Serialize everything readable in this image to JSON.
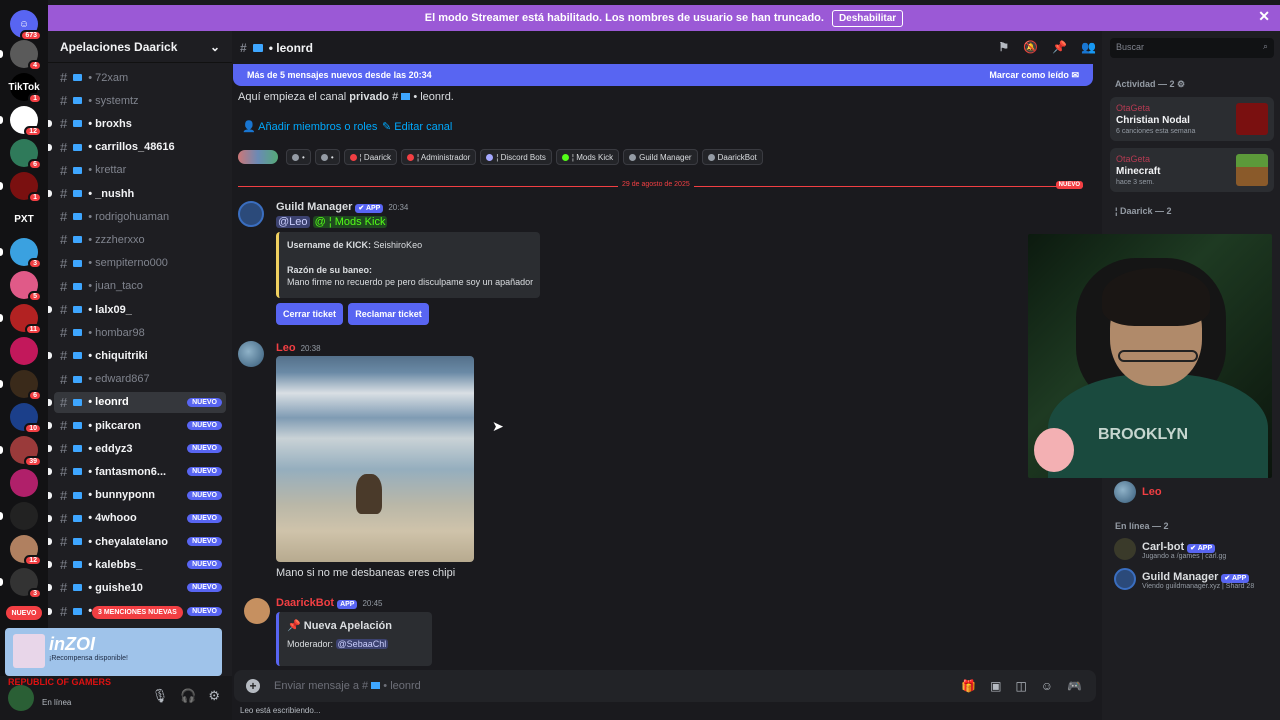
{
  "banner": {
    "text": "El modo Streamer está habilitado. Los nombres de usuario se han truncado.",
    "button": "Deshabilitar"
  },
  "rail": {
    "top_badge": "673",
    "servers": [
      {
        "badge": "4",
        "color": "#5a5a5a"
      },
      {
        "badge": "1",
        "color": "#000000",
        "label": "TikTok"
      },
      {
        "badge": "12",
        "color": "#ffffff"
      },
      {
        "badge": "6",
        "color": "#2f7a5a"
      },
      {
        "badge": "1",
        "color": "#7a1010"
      },
      {
        "label": "PXT",
        "color": "#121214"
      },
      {
        "badge": "3",
        "color": "#3aa1e0"
      },
      {
        "badge": "5",
        "color": "#e05a88"
      },
      {
        "badge": "11",
        "color": "#b22222"
      },
      {
        "badge": "",
        "color": "#c2185b"
      },
      {
        "badge": "6",
        "color": "#3a2a1a"
      },
      {
        "badge": "10",
        "color": "#1b3f8a"
      },
      {
        "badge": "39",
        "color": "#9a3a3a"
      },
      {
        "badge": "",
        "color": "#b0206a"
      },
      {
        "badge": "",
        "color": "#222"
      },
      {
        "badge": "12",
        "color": "#b08060"
      },
      {
        "badge": "3",
        "color": "#333"
      }
    ],
    "nuevo": "NUEVO"
  },
  "sidebar": {
    "server_name": "Apelaciones Daarick",
    "channels": [
      {
        "name": "72xam",
        "unread": false,
        "nuevo": ""
      },
      {
        "name": "systemtz",
        "unread": false,
        "nuevo": ""
      },
      {
        "name": "broxhs",
        "unread": true,
        "nuevo": ""
      },
      {
        "name": "carrillos_48616",
        "unread": true,
        "nuevo": ""
      },
      {
        "name": "krettar",
        "unread": false,
        "nuevo": ""
      },
      {
        "name": "_nushh",
        "unread": true,
        "nuevo": ""
      },
      {
        "name": "rodrigohuaman",
        "unread": false,
        "nuevo": ""
      },
      {
        "name": "zzzherxxo",
        "unread": false,
        "nuevo": ""
      },
      {
        "name": "sempiterno000",
        "unread": false,
        "nuevo": ""
      },
      {
        "name": "juan_taco",
        "unread": false,
        "nuevo": ""
      },
      {
        "name": "lalx09_",
        "unread": true,
        "nuevo": ""
      },
      {
        "name": "hombar98",
        "unread": false,
        "nuevo": ""
      },
      {
        "name": "chiquitriki",
        "unread": true,
        "nuevo": ""
      },
      {
        "name": "edward867",
        "unread": false,
        "nuevo": ""
      },
      {
        "name": "leonrd",
        "unread": true,
        "nuevo": "NUEVO",
        "selected": true
      },
      {
        "name": "pikcaron",
        "unread": true,
        "nuevo": "NUEVO"
      },
      {
        "name": "eddyz3",
        "unread": true,
        "nuevo": "NUEVO"
      },
      {
        "name": "fantasmon6...",
        "unread": true,
        "nuevo": "NUEVO"
      },
      {
        "name": "bunnyponn",
        "unread": true,
        "nuevo": "NUEVO"
      },
      {
        "name": "4whooo",
        "unread": true,
        "nuevo": "NUEVO"
      },
      {
        "name": "cheyalatelano",
        "unread": true,
        "nuevo": "NUEVO"
      },
      {
        "name": "kalebbs_",
        "unread": true,
        "nuevo": "NUEVO"
      },
      {
        "name": "guishe10",
        "unread": true,
        "nuevo": "NUEVO"
      },
      {
        "name": "",
        "unread": true,
        "nuevo": "NUEVO"
      }
    ],
    "mentions": "3 MENCIONES NUEVAS"
  },
  "promo": {
    "title": "inZOI",
    "subtitle": "¡Recompensa disponible!"
  },
  "user": {
    "brand": "REPUBLIC OF GAMERS",
    "status": "En línea"
  },
  "topbar": {
    "channel": "leonrd"
  },
  "newbar": {
    "text": "Más de 5 mensajes nuevos desde las 20:34",
    "action": "Marcar como leído"
  },
  "main": {
    "intro_prefix": "Aquí empieza el canal",
    "intro_bold": "privado",
    "intro_chan": "leonrd.",
    "add_members": "Añadir miembros o roles",
    "edit_channel": "Editar canal",
    "roles": [
      {
        "label": "•",
        "color": "#949ba4"
      },
      {
        "label": "•",
        "color": "#949ba4"
      },
      {
        "label": "¦ Daarick",
        "color": "#f23f43"
      },
      {
        "label": "¦ Administrador",
        "color": "#f23f43"
      },
      {
        "label": "¦ Discord Bots",
        "color": "#a5a8ff"
      },
      {
        "label": "¦ Mods Kick",
        "color": "#53fc18"
      },
      {
        "label": "Guild Manager",
        "color": "#949ba4"
      },
      {
        "label": "DaarickBot",
        "color": "#949ba4"
      }
    ],
    "date": "29 de agosto de 2025",
    "new_label": "NUEVO",
    "msg1": {
      "author": "Guild Manager",
      "app": "✔ APP",
      "time": "20:34",
      "mention_user": "@Leo",
      "mention_role": "@ ¦ Mods Kick",
      "f1_label": "Username de KICK:",
      "f1_value": "SeishiroKeo",
      "f2_label": "Razón de su baneo:",
      "f2_value": "Mano firme no recuerdo pe pero disculpame soy un apañador",
      "btn1": "Cerrar ticket",
      "btn2": "Reclamar ticket"
    },
    "msg2": {
      "author": "Leo",
      "time": "20:38",
      "text": "Mano si no me desbaneas eres chipi"
    },
    "msg3": {
      "author": "DaarickBot",
      "app": "APP",
      "time": "20:45",
      "title": "Nueva Apelación",
      "mod_label": "Moderador:",
      "mod_value": "@SebaaChl"
    }
  },
  "composer": {
    "placeholder_prefix": "Enviar mensaje a #",
    "channel": "leonrd"
  },
  "typing": "Leo está escribiendo...",
  "members": {
    "search": "Buscar",
    "activity_header": "Actividad — 2",
    "act1": {
      "tag": "OtaGeta",
      "name": "Christian Nodal",
      "sub": "6 canciones esta semana"
    },
    "act2": {
      "tag": "OtaGeta",
      "name": "Minecraft",
      "sub": "hace 3 sem."
    },
    "group1": "¦ Daarick — 2",
    "leo": "Leo",
    "online_header": "En línea — 2",
    "m1": {
      "name": "Carl-bot",
      "app": "✔ APP",
      "status": "Jugando a /games | carl.gg"
    },
    "m2": {
      "name": "Guild Manager",
      "app": "✔ APP",
      "status": "Viendo guildmanager.xyz | Shard 28"
    }
  },
  "colors": {
    "blurple": "#5865f2",
    "red": "#f23f43",
    "banner": "#9b59d6",
    "embed_bar": "#f0d060"
  }
}
